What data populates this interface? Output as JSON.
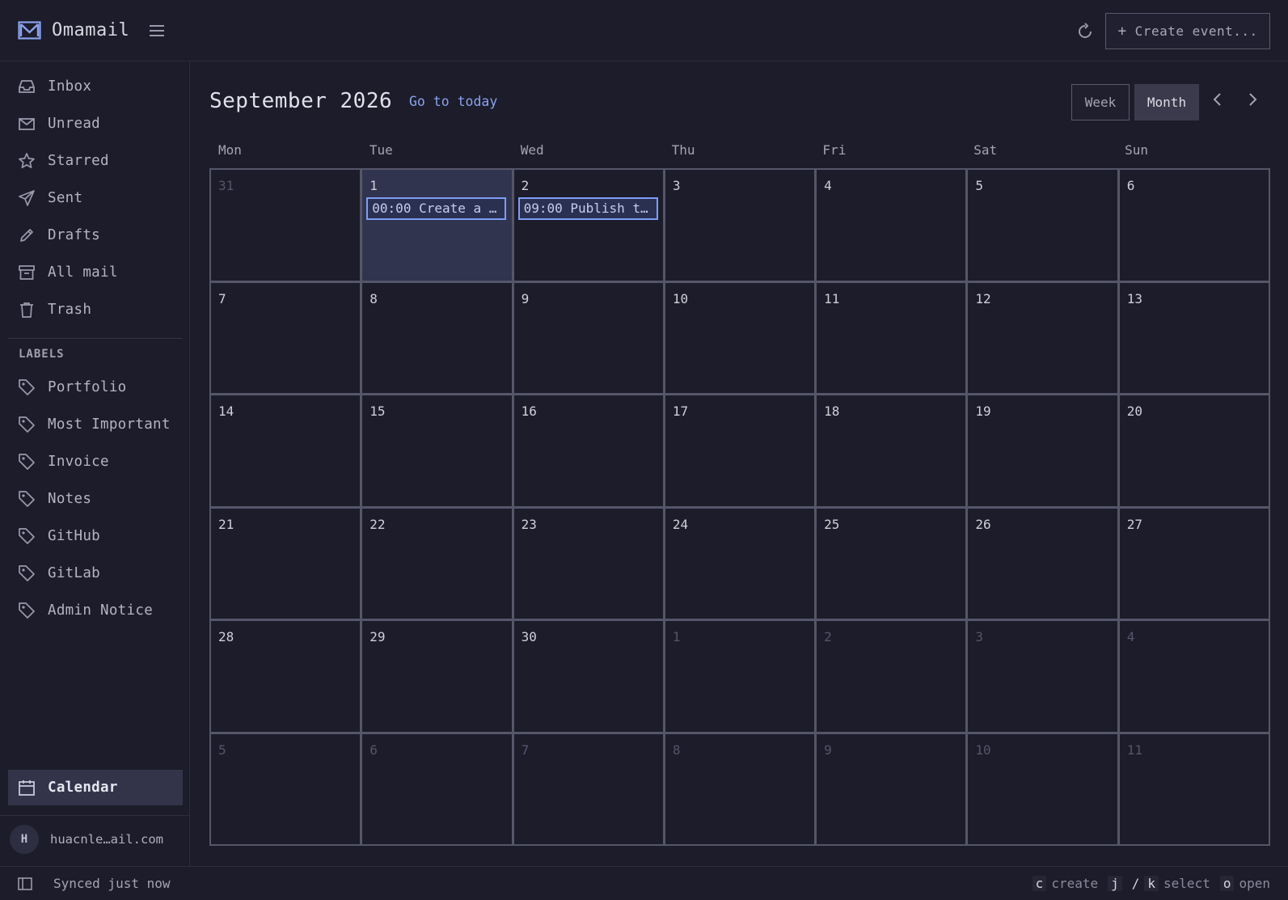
{
  "app": {
    "name": "Omamail",
    "create_button_label": "Create event..."
  },
  "sidebar": {
    "nav": [
      {
        "label": "Inbox",
        "icon": "inbox-icon"
      },
      {
        "label": "Unread",
        "icon": "mail-icon"
      },
      {
        "label": "Starred",
        "icon": "star-icon"
      },
      {
        "label": "Sent",
        "icon": "send-icon"
      },
      {
        "label": "Drafts",
        "icon": "pencil-icon"
      },
      {
        "label": "All mail",
        "icon": "archive-icon"
      },
      {
        "label": "Trash",
        "icon": "trash-icon"
      }
    ],
    "labels_heading": "LABELS",
    "labels": [
      {
        "label": "Portfolio"
      },
      {
        "label": "Most Important"
      },
      {
        "label": "Invoice"
      },
      {
        "label": "Notes"
      },
      {
        "label": "GitHub"
      },
      {
        "label": "GitLab"
      },
      {
        "label": "Admin Notice"
      }
    ],
    "calendar_label": "Calendar",
    "account": {
      "initial": "H",
      "email": "huacnle…ail.com"
    }
  },
  "calendar": {
    "title": "September 2026",
    "go_to_today": "Go to today",
    "view_week": "Week",
    "view_month": "Month",
    "active_view": "Month",
    "weekdays": [
      "Mon",
      "Tue",
      "Wed",
      "Thu",
      "Fri",
      "Sat",
      "Sun"
    ],
    "days": [
      {
        "n": "31",
        "muted": true
      },
      {
        "n": "1",
        "today": true,
        "event": "00:00 Create a …"
      },
      {
        "n": "2",
        "event": "09:00 Publish t…"
      },
      {
        "n": "3"
      },
      {
        "n": "4"
      },
      {
        "n": "5"
      },
      {
        "n": "6"
      },
      {
        "n": "7"
      },
      {
        "n": "8"
      },
      {
        "n": "9"
      },
      {
        "n": "10"
      },
      {
        "n": "11"
      },
      {
        "n": "12"
      },
      {
        "n": "13"
      },
      {
        "n": "14"
      },
      {
        "n": "15"
      },
      {
        "n": "16"
      },
      {
        "n": "17"
      },
      {
        "n": "18"
      },
      {
        "n": "19"
      },
      {
        "n": "20"
      },
      {
        "n": "21"
      },
      {
        "n": "22"
      },
      {
        "n": "23"
      },
      {
        "n": "24"
      },
      {
        "n": "25"
      },
      {
        "n": "26"
      },
      {
        "n": "27"
      },
      {
        "n": "28"
      },
      {
        "n": "29"
      },
      {
        "n": "30"
      },
      {
        "n": "1",
        "muted": true
      },
      {
        "n": "2",
        "muted": true
      },
      {
        "n": "3",
        "muted": true
      },
      {
        "n": "4",
        "muted": true
      },
      {
        "n": "5",
        "muted": true
      },
      {
        "n": "6",
        "muted": true
      },
      {
        "n": "7",
        "muted": true
      },
      {
        "n": "8",
        "muted": true
      },
      {
        "n": "9",
        "muted": true
      },
      {
        "n": "10",
        "muted": true
      },
      {
        "n": "11",
        "muted": true
      }
    ]
  },
  "status": {
    "sync_text": "Synced just now",
    "shortcuts": {
      "create_key": "c",
      "create_label": "create",
      "select_key_1": "j",
      "select_sep": "/",
      "select_key_2": "k",
      "select_label": "select",
      "open_key": "o",
      "open_label": "open"
    }
  },
  "colors": {
    "background": "#1c1c2a",
    "accent": "#7e9cf6",
    "today_cell": "#30344e",
    "active_nav": "#33344a"
  }
}
